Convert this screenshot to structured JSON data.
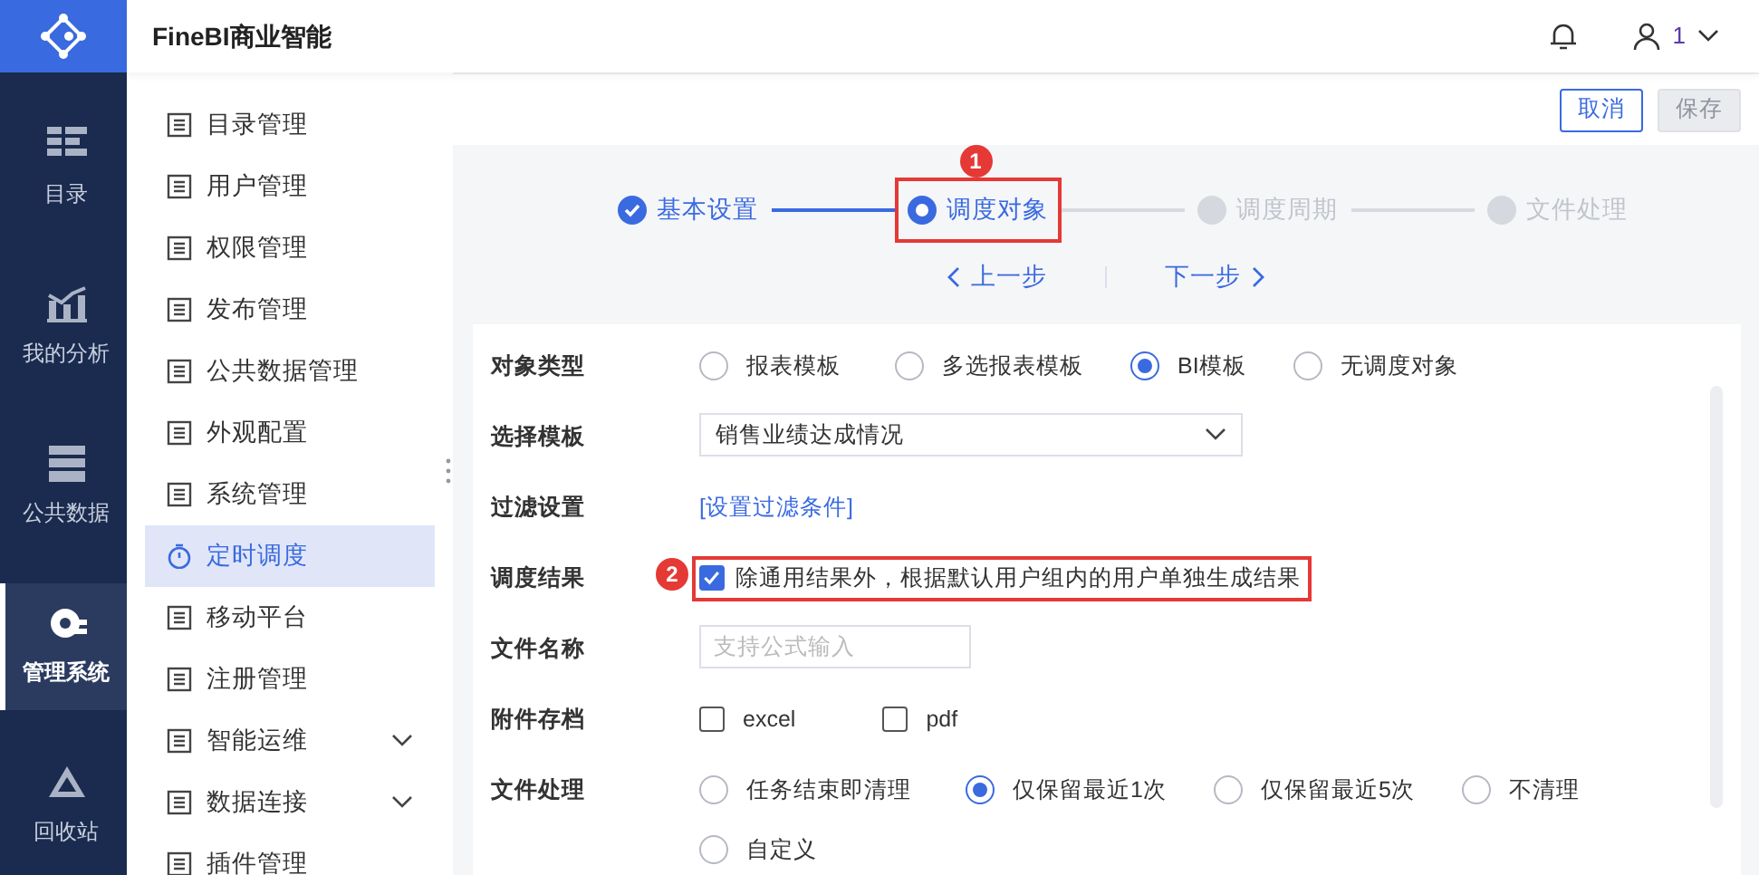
{
  "app_title": "FineBI商业智能",
  "rail": [
    {
      "label": "目录",
      "selected": false
    },
    {
      "label": "我的分析",
      "selected": false
    },
    {
      "label": "公共数据",
      "selected": false
    },
    {
      "label": "管理系统",
      "selected": true
    },
    {
      "label": "回收站",
      "selected": false
    }
  ],
  "header": {
    "user": "1"
  },
  "menu": [
    {
      "label": "目录管理",
      "selected": false,
      "expandable": false
    },
    {
      "label": "用户管理",
      "selected": false,
      "expandable": false
    },
    {
      "label": "权限管理",
      "selected": false,
      "expandable": false
    },
    {
      "label": "发布管理",
      "selected": false,
      "expandable": false
    },
    {
      "label": "公共数据管理",
      "selected": false,
      "expandable": false
    },
    {
      "label": "外观配置",
      "selected": false,
      "expandable": false
    },
    {
      "label": "系统管理",
      "selected": false,
      "expandable": false
    },
    {
      "label": "定时调度",
      "selected": true,
      "expandable": false
    },
    {
      "label": "移动平台",
      "selected": false,
      "expandable": false
    },
    {
      "label": "注册管理",
      "selected": false,
      "expandable": false
    },
    {
      "label": "智能运维",
      "selected": false,
      "expandable": true
    },
    {
      "label": "数据连接",
      "selected": false,
      "expandable": true
    },
    {
      "label": "插件管理",
      "selected": false,
      "expandable": false
    }
  ],
  "toolbar": [
    {
      "label": "取消",
      "disabled": false
    },
    {
      "label": "保存",
      "disabled": true
    }
  ],
  "steps": [
    {
      "label": "基本设置",
      "completed": true,
      "selected": false,
      "highlighted": false
    },
    {
      "label": "调度对象",
      "completed": false,
      "selected": true,
      "highlighted": true,
      "badge": "1"
    },
    {
      "label": "调度周期",
      "completed": false,
      "selected": false,
      "highlighted": false
    },
    {
      "label": "文件处理",
      "completed": false,
      "selected": false,
      "highlighted": false
    }
  ],
  "step_nav": {
    "prev": "上一步",
    "next": "下一步"
  },
  "form": [
    {
      "label": "对象类型",
      "kind": "radios",
      "options": [
        {
          "label": "报表模板",
          "selected": false
        },
        {
          "label": "多选报表模板",
          "selected": false
        },
        {
          "label": "BI模板",
          "selected": true
        },
        {
          "label": "无调度对象",
          "selected": false
        }
      ]
    },
    {
      "label": "选择模板",
      "kind": "select",
      "value": "销售业绩达成情况"
    },
    {
      "label": "过滤设置",
      "kind": "link",
      "text": "[设置过滤条件]"
    },
    {
      "label": "调度结果",
      "kind": "checkbox",
      "text": "除通用结果外，根据默认用户组内的用户单独生成结果",
      "checked": true,
      "highlighted": true,
      "badge": "2"
    },
    {
      "label": "文件名称",
      "kind": "input",
      "placeholder": "支持公式输入"
    },
    {
      "label": "附件存档",
      "kind": "checkboxes",
      "options": [
        {
          "label": "excel",
          "checked": false
        },
        {
          "label": "pdf",
          "checked": false
        }
      ]
    },
    {
      "label": "文件处理",
      "kind": "radios",
      "options": [
        {
          "label": "任务结束即清理",
          "selected": false
        },
        {
          "label": "仅保留最近1次",
          "selected": true
        },
        {
          "label": "仅保留最近5次",
          "selected": false
        },
        {
          "label": "不清理",
          "selected": false
        },
        {
          "label": "自定义",
          "selected": false
        }
      ]
    }
  ]
}
